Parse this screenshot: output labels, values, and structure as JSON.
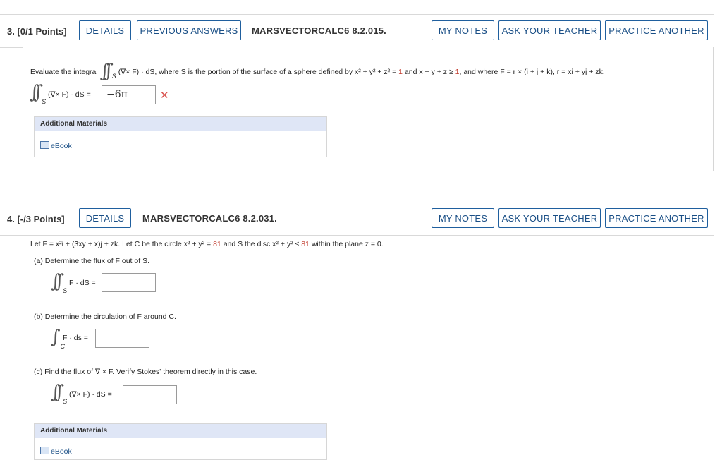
{
  "q3": {
    "number": "3.",
    "points": "[0/1 Points]",
    "details_label": "DETAILS",
    "previous_label": "PREVIOUS ANSWERS",
    "code": "MARSVECTORCALC6 8.2.015.",
    "my_notes_label": "MY NOTES",
    "ask_label": "ASK YOUR TEACHER",
    "practice_label": "PRACTICE ANOTHER",
    "prompt_start": "Evaluate the integral",
    "prompt_rest": "(∇× F) · dS, where S is the portion of the surface of a sphere defined by x² + y² + z² = ",
    "one_a": "1",
    "prompt_mid": " and x + y + z ≥ ",
    "one_b": "1",
    "prompt_end": ", and where F = r × (i + j + k), r = xi + yj + zk.",
    "answer_lhs": "(∇× F) · dS =",
    "answer_value": "−6π",
    "wrong_mark": "✕",
    "additional_materials": "Additional Materials",
    "ebook": "eBook"
  },
  "q4": {
    "number": "4.",
    "points": "[-/3 Points]",
    "details_label": "DETAILS",
    "code": "MARSVECTORCALC6 8.2.031.",
    "my_notes_label": "MY NOTES",
    "ask_label": "ASK YOUR TEACHER",
    "practice_label": "PRACTICE ANOTHER",
    "prompt_a": "Let F = x²i + (3xy + x)j + zk. Let C be the circle x² + y² = ",
    "eightyone_a": "81",
    "prompt_b": " and S the disc x² + y² ≤ ",
    "eightyone_b": "81",
    "prompt_c": " within the plane z = 0.",
    "part_a": "(a)   Determine the flux of F out of S.",
    "part_a_lhs": "F · dS =",
    "part_b": "(b)   Determine the circulation of F around C.",
    "part_b_lhs": "F · ds =",
    "part_c": "(c)   Find the flux of ∇ × F. Verify Stokes' theorem directly in this case.",
    "part_c_lhs": "(∇× F) · dS =",
    "additional_materials": "Additional Materials",
    "ebook": "eBook"
  }
}
